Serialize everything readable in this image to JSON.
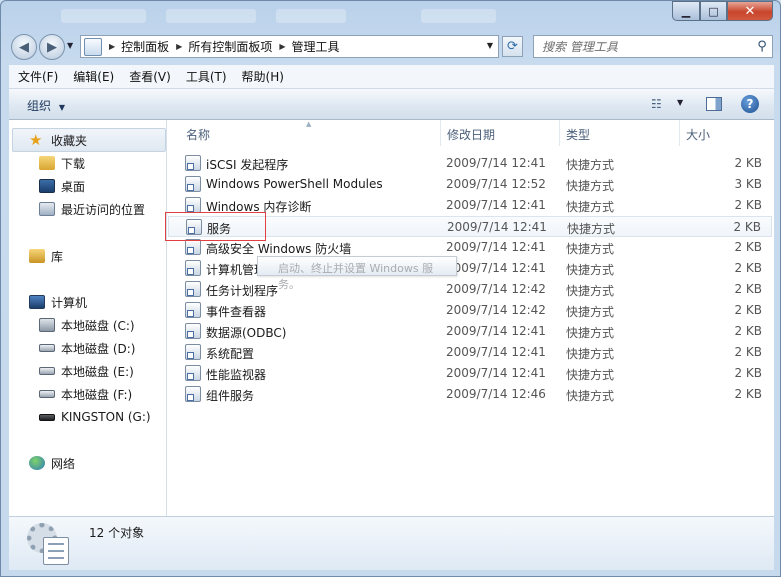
{
  "address": {
    "crumbs": [
      "控制面板",
      "所有控制面板项",
      "管理工具"
    ]
  },
  "search": {
    "placeholder": "搜索 管理工具"
  },
  "menu": [
    "文件(F)",
    "编辑(E)",
    "查看(V)",
    "工具(T)",
    "帮助(H)"
  ],
  "toolbar": {
    "organize": "组织"
  },
  "nav": {
    "favorites": "收藏夹",
    "downloads": "下载",
    "desktop": "桌面",
    "recent": "最近访问的位置",
    "library": "库",
    "computer": "计算机",
    "drives": [
      "本地磁盘 (C:)",
      "本地磁盘 (D:)",
      "本地磁盘 (E:)",
      "本地磁盘 (F:)",
      "KINGSTON (G:)"
    ],
    "network": "网络"
  },
  "columns": {
    "name": "名称",
    "date": "修改日期",
    "type": "类型",
    "size": "大小"
  },
  "files": [
    {
      "name": "iSCSI 发起程序",
      "date": "2009/7/14 12:41",
      "type": "快捷方式",
      "size": "2 KB"
    },
    {
      "name": "Windows PowerShell Modules",
      "date": "2009/7/14 12:52",
      "type": "快捷方式",
      "size": "3 KB"
    },
    {
      "name": "Windows 内存诊断",
      "date": "2009/7/14 12:41",
      "type": "快捷方式",
      "size": "2 KB"
    },
    {
      "name": "服务",
      "date": "2009/7/14 12:41",
      "type": "快捷方式",
      "size": "2 KB"
    },
    {
      "name": "高级安全 Windows 防火墙",
      "date": "2009/7/14 12:41",
      "type": "快捷方式",
      "size": "2 KB"
    },
    {
      "name": "计算机管理",
      "date": "2009/7/14 12:41",
      "type": "快捷方式",
      "size": "2 KB"
    },
    {
      "name": "任务计划程序",
      "date": "2009/7/14 12:42",
      "type": "快捷方式",
      "size": "2 KB"
    },
    {
      "name": "事件查看器",
      "date": "2009/7/14 12:42",
      "type": "快捷方式",
      "size": "2 KB"
    },
    {
      "name": "数据源(ODBC)",
      "date": "2009/7/14 12:41",
      "type": "快捷方式",
      "size": "2 KB"
    },
    {
      "name": "系统配置",
      "date": "2009/7/14 12:41",
      "type": "快捷方式",
      "size": "2 KB"
    },
    {
      "name": "性能监视器",
      "date": "2009/7/14 12:41",
      "type": "快捷方式",
      "size": "2 KB"
    },
    {
      "name": "组件服务",
      "date": "2009/7/14 12:46",
      "type": "快捷方式",
      "size": "2 KB"
    }
  ],
  "tooltip": "启动、终止并设置 Windows 服务。",
  "status": {
    "count": "12 个对象"
  },
  "colors": {
    "highlight": "#e04040",
    "accent": "#2f6da8"
  }
}
